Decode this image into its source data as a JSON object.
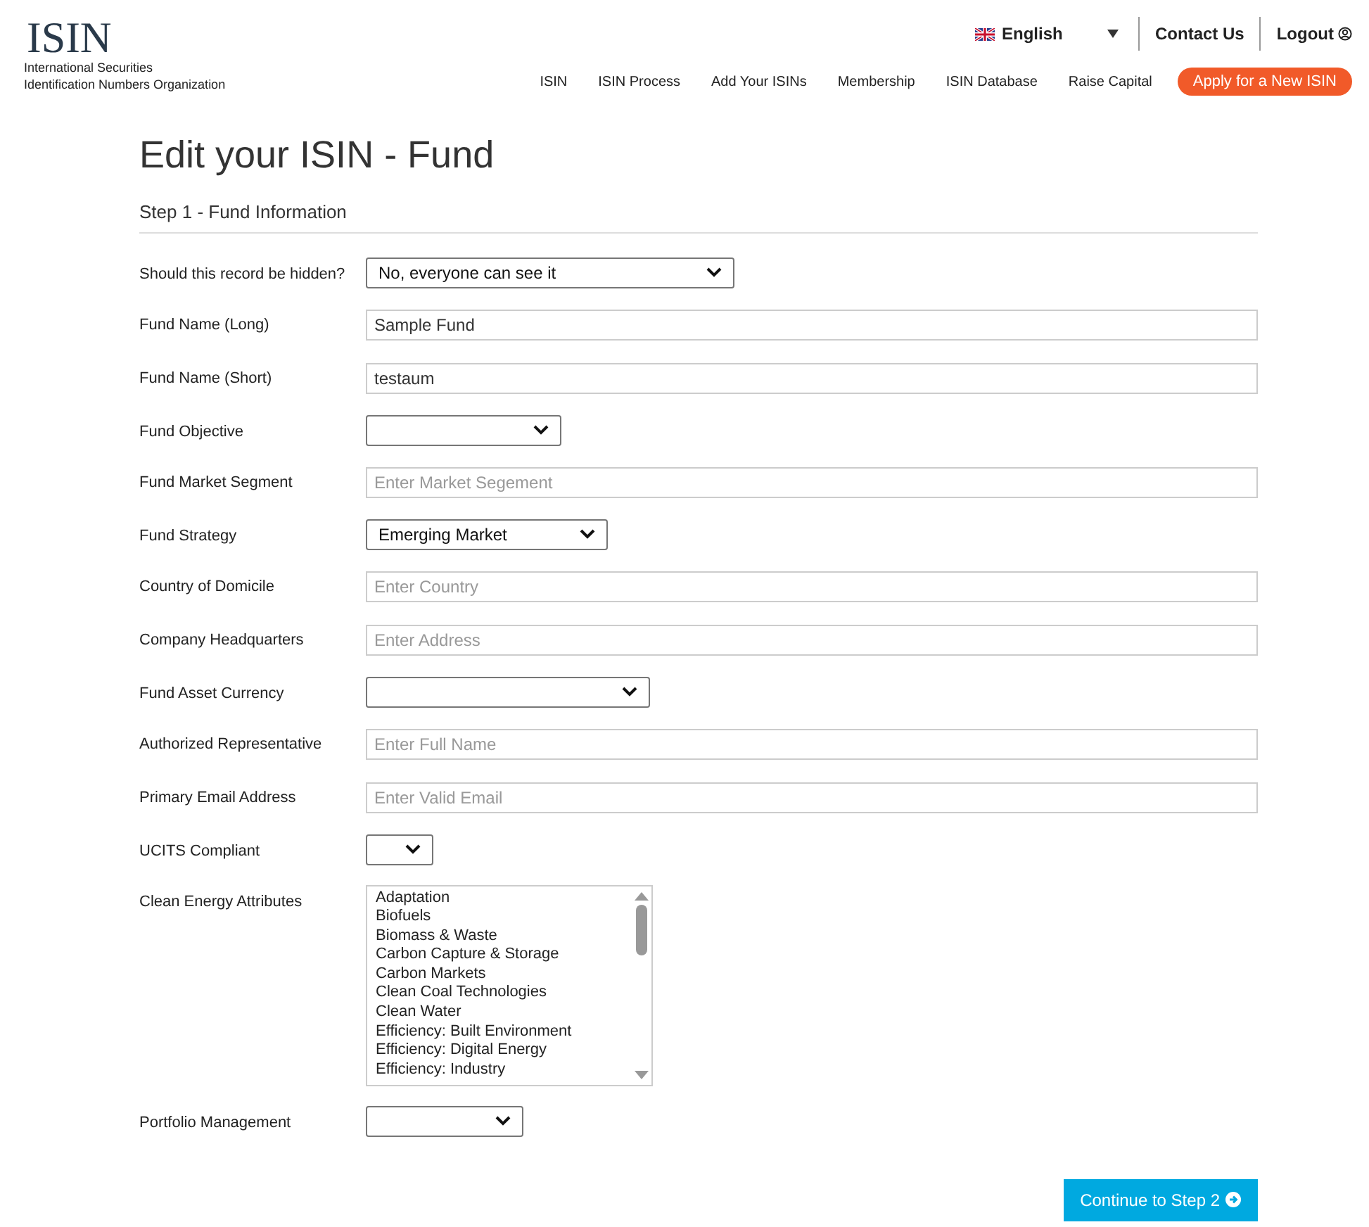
{
  "logo": {
    "mark": "ISIN",
    "tagline": [
      "International Securities",
      "Identification Numbers Organization"
    ]
  },
  "top_links": {
    "language": "English",
    "contact": "Contact Us",
    "logout": "Logout"
  },
  "nav": [
    "ISIN",
    "ISIN Process",
    "Add Your ISINs",
    "Membership",
    "ISIN Database",
    "Raise Capital"
  ],
  "nav_cta": "Apply for a New ISIN",
  "title": "Edit your ISIN - Fund",
  "step": "Step 1 - Fund Information",
  "fields": [
    {
      "label": "Should this record be hidden?",
      "kind": "select",
      "value": "No, everyone can see it"
    },
    {
      "label": "Fund Name (Long)",
      "kind": "text",
      "value": "Sample Fund"
    },
    {
      "label": "Fund Name (Short)",
      "kind": "text",
      "value": "testaum"
    },
    {
      "label": "Fund Objective",
      "kind": "select"
    },
    {
      "label": "Fund Market Segment",
      "kind": "text",
      "placeholder": "Enter Market Segement"
    },
    {
      "label": "Fund Strategy",
      "kind": "select",
      "value": "Emerging Market"
    },
    {
      "label": "Country of Domicile",
      "kind": "text",
      "placeholder": "Enter Country"
    },
    {
      "label": "Company Headquarters",
      "kind": "text",
      "placeholder": "Enter Address"
    },
    {
      "label": "Fund Asset Currency",
      "kind": "select"
    },
    {
      "label": "Authorized Representative",
      "kind": "text",
      "placeholder": "Enter Full Name"
    },
    {
      "label": "Primary Email Address",
      "kind": "text",
      "placeholder": "Enter Valid Email"
    },
    {
      "label": "UCITS Compliant",
      "kind": "select"
    },
    {
      "label": "Clean Energy Attributes",
      "kind": "listbox",
      "options": [
        "Adaptation",
        "Biofuels",
        "Biomass & Waste",
        "Carbon Capture & Storage",
        "Carbon Markets",
        "Clean Coal Technologies",
        "Clean Water",
        "Efficiency: Built Environment",
        "Efficiency: Digital Energy",
        "Efficiency: Industry"
      ]
    },
    {
      "label": "Portfolio Management",
      "kind": "select"
    }
  ],
  "submit": "Continue to Step 2"
}
